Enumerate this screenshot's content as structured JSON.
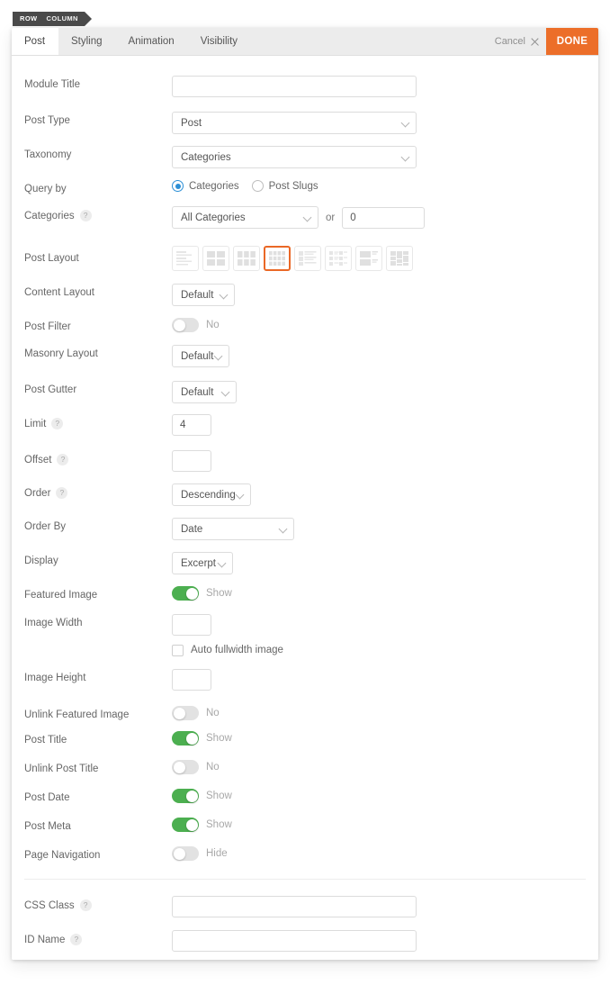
{
  "breadcrumb": {
    "row": "ROW",
    "column": "COLUMN"
  },
  "tabs": [
    {
      "label": "Post",
      "active": true
    },
    {
      "label": "Styling",
      "active": false
    },
    {
      "label": "Animation",
      "active": false
    },
    {
      "label": "Visibility",
      "active": false
    }
  ],
  "actions": {
    "cancel_label": "Cancel",
    "done_label": "DONE"
  },
  "colors": {
    "accent_orange": "#ec6e29",
    "toggle_on_green": "#4caf50",
    "radio_blue": "#2c8fd6",
    "tabbar_bg": "#ececec"
  },
  "fields": {
    "module_title": {
      "label": "Module Title",
      "value": "",
      "placeholder": ""
    },
    "post_type": {
      "label": "Post Type",
      "value": "Post"
    },
    "taxonomy": {
      "label": "Taxonomy",
      "value": "Categories"
    },
    "query_by": {
      "label": "Query by",
      "options": [
        {
          "label": "Categories",
          "selected": true
        },
        {
          "label": "Post Slugs",
          "selected": false
        }
      ]
    },
    "categories": {
      "label": "Categories",
      "help": "?",
      "value": "All Categories",
      "or_text": "or",
      "or_value": "0"
    },
    "post_layout": {
      "label": "Post Layout",
      "selected_index": 3,
      "options": [
        "list-layout",
        "grid-2-col-layout",
        "grid-3-col-layout",
        "grid-4-col-layout",
        "media-list-layout",
        "zigzag-layout",
        "left-thumb-layout",
        "masonry-layout"
      ]
    },
    "content_layout": {
      "label": "Content Layout",
      "value": "Default"
    },
    "post_filter": {
      "label": "Post Filter",
      "state": "No",
      "on": false
    },
    "masonry_layout": {
      "label": "Masonry Layout",
      "value": "Default"
    },
    "post_gutter": {
      "label": "Post Gutter",
      "value": "Default"
    },
    "limit": {
      "label": "Limit",
      "help": "?",
      "value": "4"
    },
    "offset": {
      "label": "Offset",
      "help": "?",
      "value": ""
    },
    "order": {
      "label": "Order",
      "help": "?",
      "value": "Descending"
    },
    "order_by": {
      "label": "Order By",
      "value": "Date"
    },
    "display": {
      "label": "Display",
      "value": "Excerpt"
    },
    "featured_image": {
      "label": "Featured Image",
      "state": "Show",
      "on": true
    },
    "image_width": {
      "label": "Image Width",
      "value": ""
    },
    "auto_fullwidth": {
      "label": "Auto fullwidth image",
      "checked": false
    },
    "image_height": {
      "label": "Image Height",
      "value": ""
    },
    "unlink_featured_image": {
      "label": "Unlink Featured Image",
      "state": "No",
      "on": false
    },
    "post_title": {
      "label": "Post Title",
      "state": "Show",
      "on": true
    },
    "unlink_post_title": {
      "label": "Unlink Post Title",
      "state": "No",
      "on": false
    },
    "post_date": {
      "label": "Post Date",
      "state": "Show",
      "on": true
    },
    "post_meta": {
      "label": "Post Meta",
      "state": "Show",
      "on": true
    },
    "page_navigation": {
      "label": "Page Navigation",
      "state": "Hide",
      "on": false
    },
    "css_class": {
      "label": "CSS Class",
      "help": "?",
      "value": ""
    },
    "id_name": {
      "label": "ID Name",
      "help": "?",
      "value": ""
    }
  }
}
